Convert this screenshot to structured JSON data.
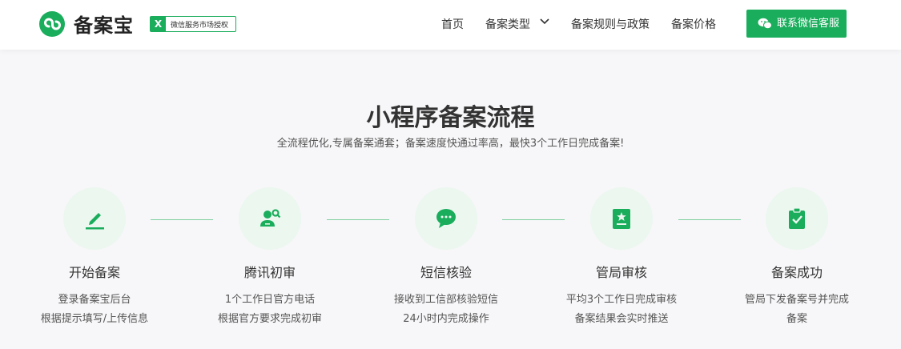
{
  "header": {
    "brand": "备案宝",
    "badge_mark": "X",
    "badge_text": "微信服务市场授权",
    "nav": [
      "首页",
      "备案类型",
      "备案规则与政策",
      "备案价格"
    ],
    "cta": "联系微信客服"
  },
  "main": {
    "title": "小程序备案流程",
    "subtitle": "全流程优化,专属备案通套；备案速度快通过率高，最快3个工作日完成备案!"
  },
  "steps": [
    {
      "name": "开始备案",
      "desc1": "登录备案宝后台",
      "desc2": "根据提示填写/上传信息",
      "icon": "pencil-icon"
    },
    {
      "name": "腾讯初审",
      "desc1": "1个工作日官方电话",
      "desc2": "根据官方要求完成初审",
      "icon": "user-review-icon"
    },
    {
      "name": "短信核验",
      "desc1": "接收到工信部核验短信",
      "desc2": "24小时内完成操作",
      "icon": "chat-bubble-icon"
    },
    {
      "name": "管局审核",
      "desc1": "平均3个工作日完成审核",
      "desc2": "备案结果会实时推送",
      "icon": "certificate-icon"
    },
    {
      "name": "备案成功",
      "desc1": "管局下发备案号并完成",
      "desc2": "备案",
      "icon": "clipboard-check-icon"
    }
  ],
  "colors": {
    "accent": "#1aad5c",
    "accent_light": "#ebf7ef",
    "background": "#f7f7f9"
  }
}
